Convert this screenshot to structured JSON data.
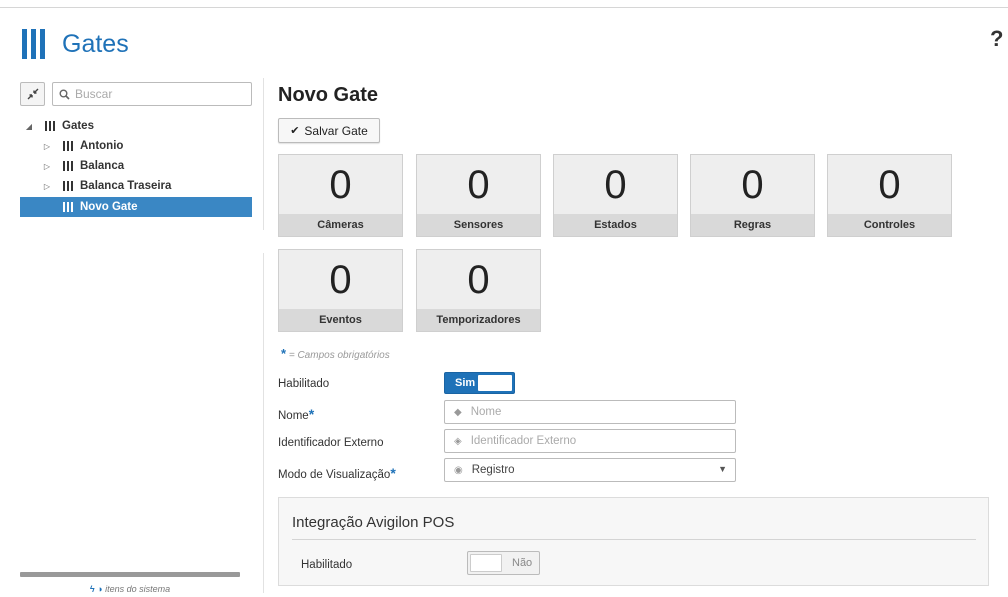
{
  "app": {
    "title": "Gates",
    "help_icon": "help-icon",
    "help_label": "?"
  },
  "colors": {
    "accent": "#1f72b8",
    "selected": "#3a87c4"
  },
  "sidebar": {
    "search_placeholder": "Buscar",
    "tree": [
      {
        "label": "Gates",
        "level": 0,
        "expanded": true
      },
      {
        "label": "Antonio",
        "level": 1
      },
      {
        "label": "Balanca",
        "level": 1
      },
      {
        "label": "Balanca Traseira",
        "level": 1
      },
      {
        "label": "Novo Gate",
        "level": 1,
        "selected": true
      }
    ],
    "footer": "itens do sistema"
  },
  "main": {
    "title": "Novo Gate",
    "save_label": "Salvar Gate",
    "tiles": [
      {
        "count": "0",
        "label": "Câmeras"
      },
      {
        "count": "0",
        "label": "Sensores"
      },
      {
        "count": "0",
        "label": "Estados"
      },
      {
        "count": "0",
        "label": "Regras"
      },
      {
        "count": "0",
        "label": "Controles"
      },
      {
        "count": "0",
        "label": "Eventos"
      },
      {
        "count": "0",
        "label": "Temporizadores"
      }
    ],
    "required_note": "= Campos obrigatórios",
    "form": {
      "enabled_label": "Habilitado",
      "enabled_value": "Sim",
      "name_label": "Nome",
      "name_placeholder": "Nome",
      "external_id_label": "Identificador Externo",
      "external_id_placeholder": "Identificador Externo",
      "view_mode_label": "Modo de Visualização",
      "view_mode_value": "Registro"
    },
    "integration": {
      "title": "Integração Avigilon POS",
      "enabled_label": "Habilitado",
      "enabled_value": "Não"
    }
  }
}
